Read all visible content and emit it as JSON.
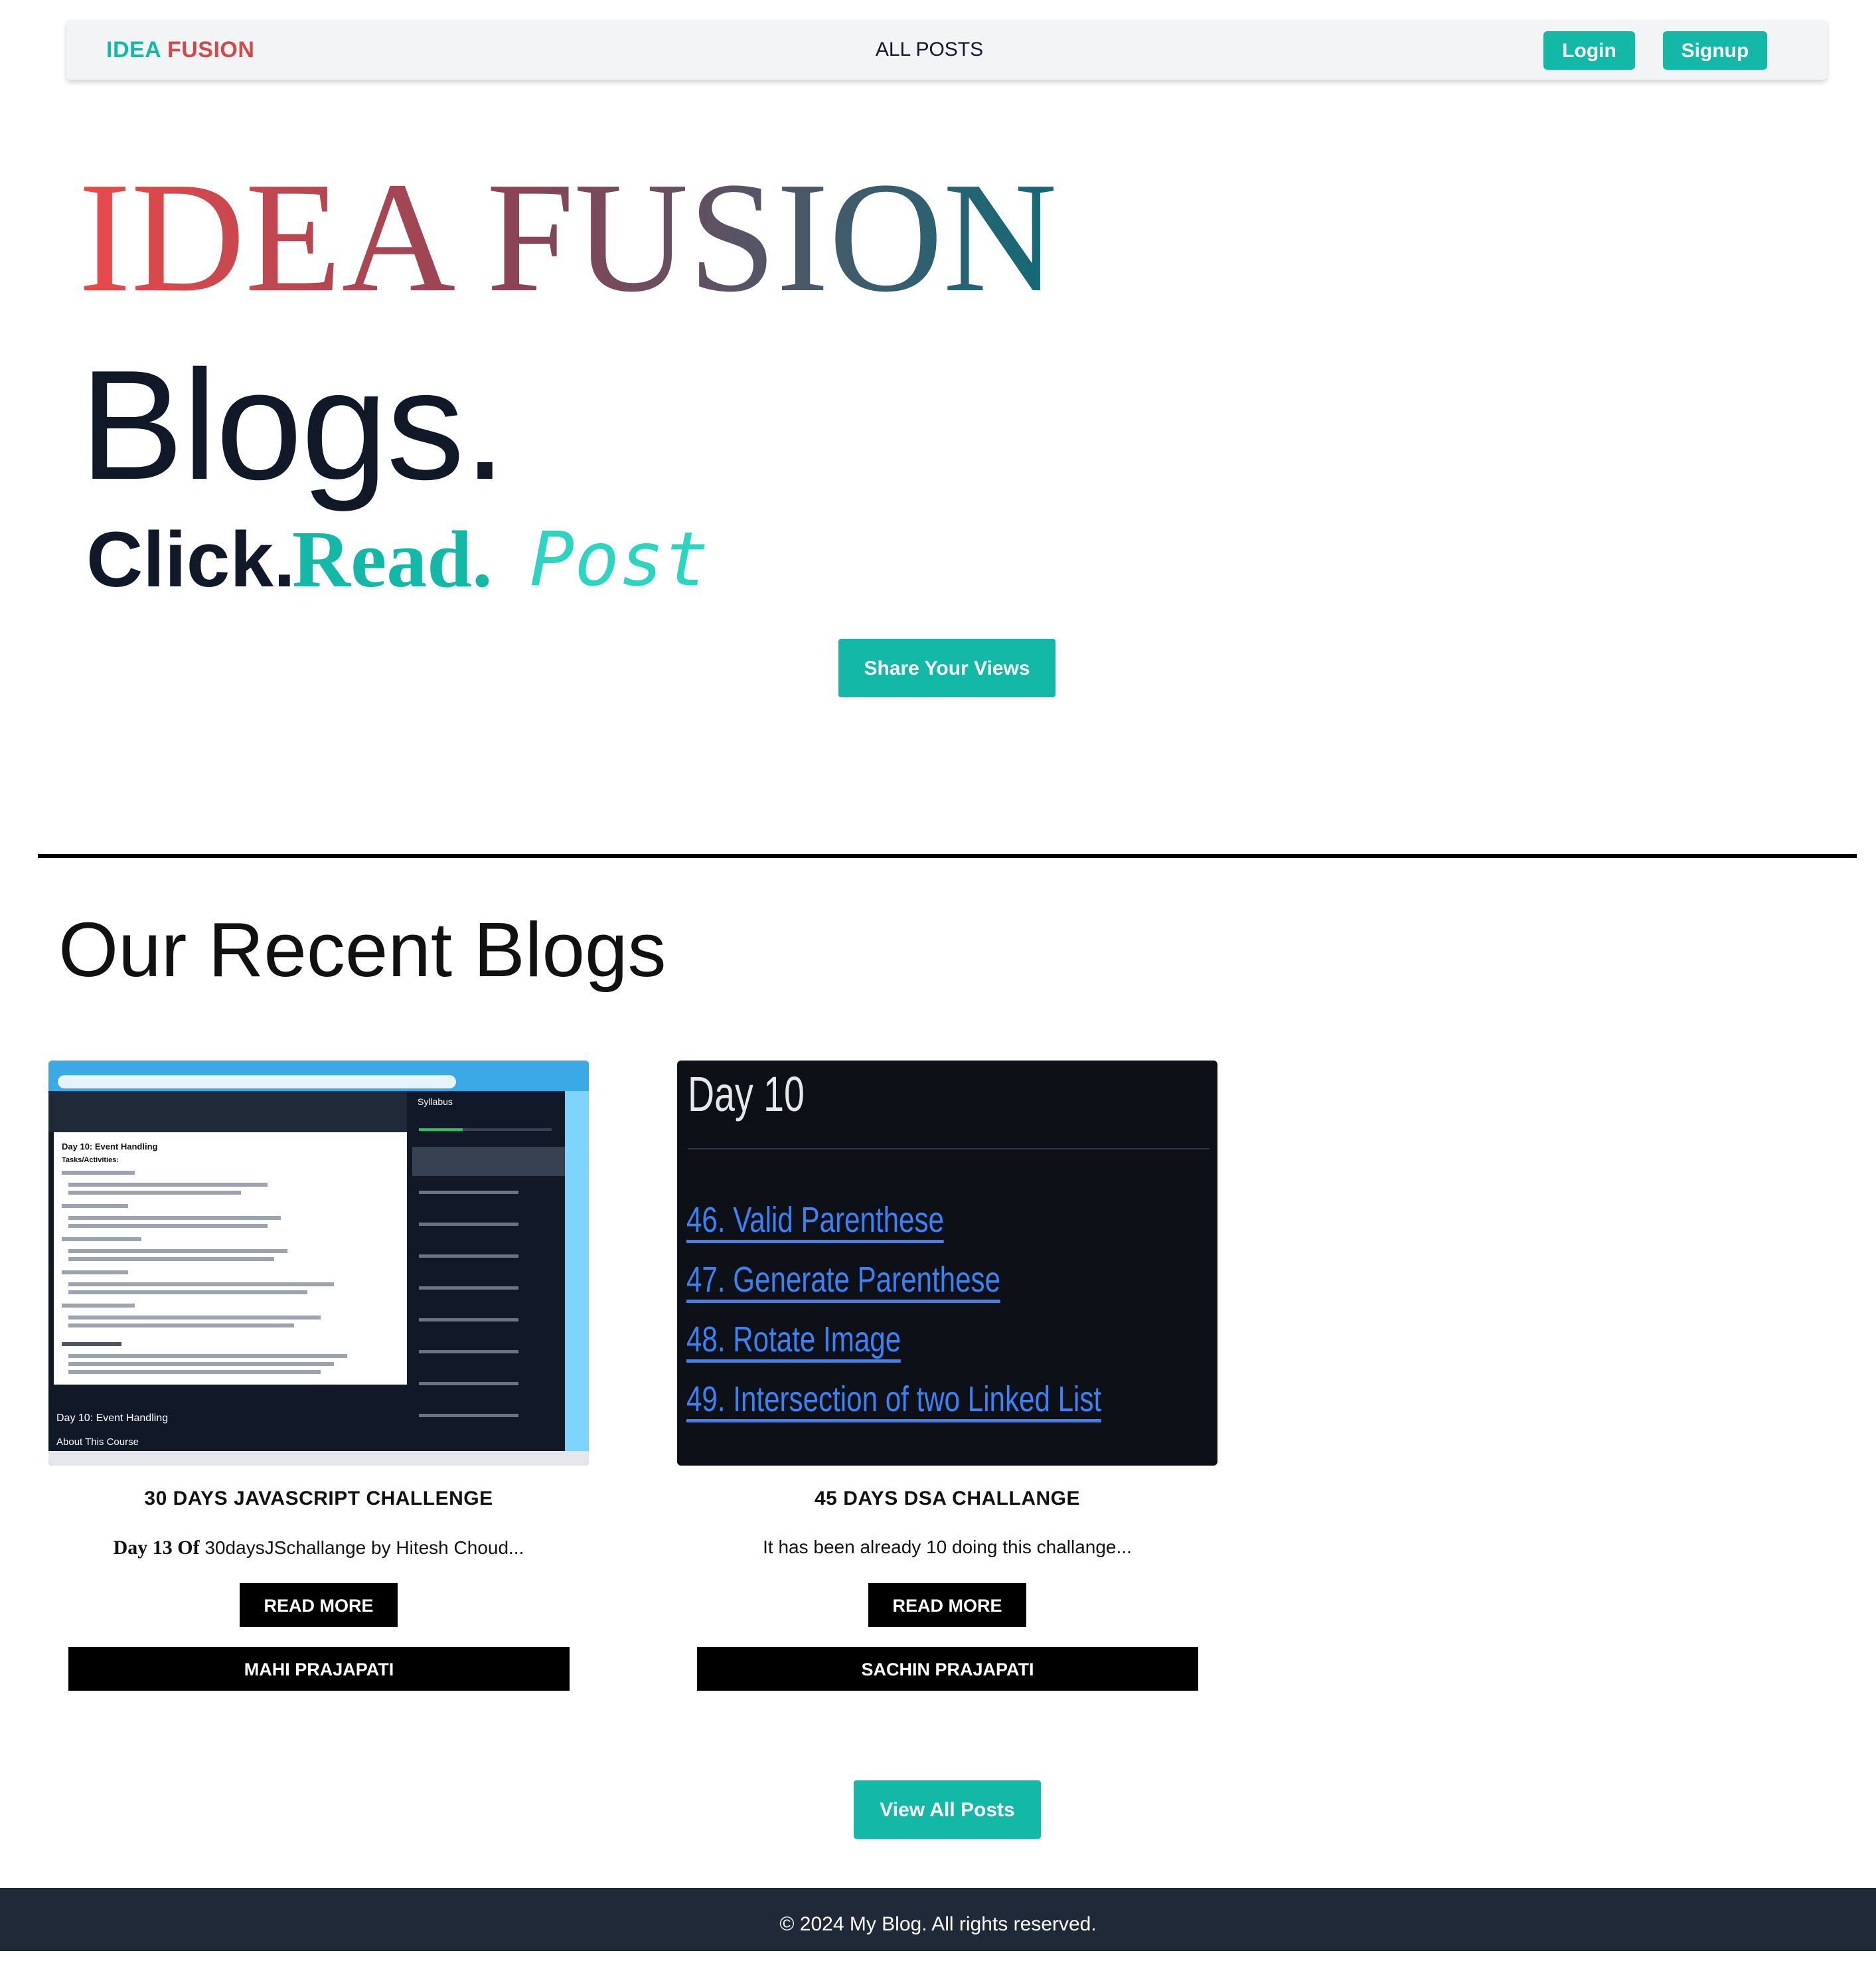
{
  "nav": {
    "brand_part1": "IDEA",
    "brand_part2": "FUSION",
    "all_posts": "ALL POSTS",
    "login": "Login",
    "signup": "Signup"
  },
  "hero": {
    "title": "IDEA FUSION",
    "subtitle": "Blogs.",
    "tagline_click": "Click.",
    "tagline_read": "Read.",
    "tagline_post": "Post",
    "share_button": "Share Your Views"
  },
  "recent": {
    "heading": "Our Recent Blogs",
    "posts": [
      {
        "title": "30 DAYS JAVASCRIPT CHALLENGE",
        "excerpt_bold": "Day 13 Of",
        "excerpt": "30daysJSchallange by Hitesh Choud...",
        "read_more": "READ MORE",
        "author": "MAHI PRAJAPATI",
        "thumbnail": {
          "doc_title": "Day 10: Event Handling",
          "doc_subtitle": "Tasks/Activities:",
          "panel_title": "Syllabus",
          "lower_title": "Day 10: Event Handling",
          "lower_subtitle": "About This Course"
        }
      },
      {
        "title": "45 DAYS DSA CHALLANGE",
        "excerpt_bold": "",
        "excerpt": "It has been already 10 doing this challange...",
        "read_more": "READ MORE",
        "author": "SACHIN PRAJAPATI",
        "thumbnail": {
          "day": "Day 10",
          "items": [
            "46. Valid Parenthese",
            "47. Generate Parenthese",
            "48. Rotate Image",
            "49. Intersection of two Linked List"
          ]
        }
      }
    ]
  },
  "view_all": "View All Posts",
  "footer": "© 2024 My Blog. All rights reserved.",
  "colors": {
    "accent": "#14b8a6",
    "brand_red": "#d14a4a",
    "footer_bg": "#1f2937",
    "text_dark": "#111827"
  }
}
